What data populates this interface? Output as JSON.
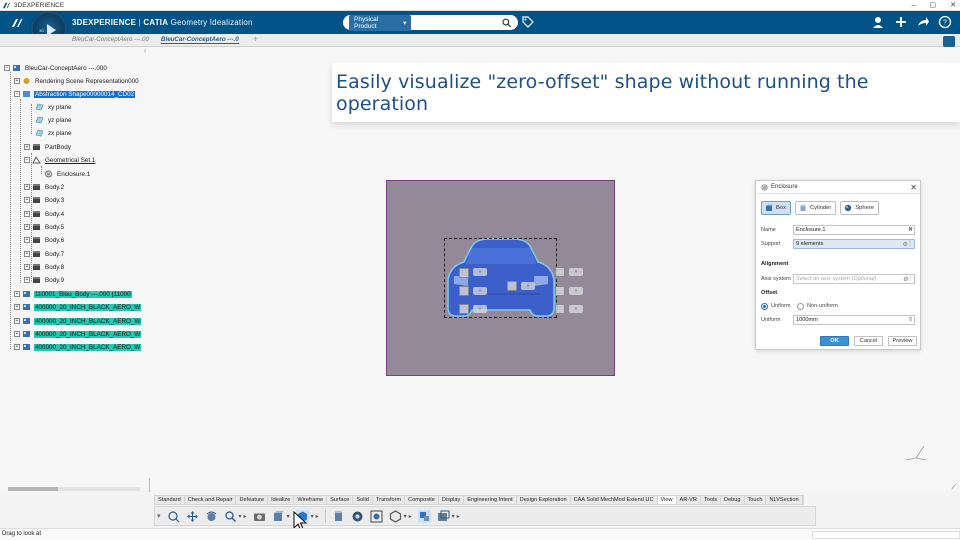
{
  "os": {
    "title": "3DEXPERIENCE"
  },
  "header": {
    "brand_bold": "3DEXPERIENCE",
    "brand_sep": " | ",
    "brand_product": "CATIA",
    "brand_app": " Geometry Idealization",
    "search_scope": "Physical Product",
    "search_value": "",
    "compass_version": "V.R",
    "compass_num": "3D"
  },
  "tabs": [
    {
      "label": "BleuCar-ConceptAero ---.00"
    },
    {
      "label": "BleuCar-ConceptAero ---.0"
    }
  ],
  "tab_add": "+",
  "tree": [
    {
      "label": "BleuCar-ConceptAero ---.000"
    },
    {
      "label": "Rendering Scene Representation000"
    },
    {
      "label": "Abstraction Shape00000014_CD02"
    },
    {
      "label": "xy plane"
    },
    {
      "label": "yz plane"
    },
    {
      "label": "zx plane"
    },
    {
      "label": "PartBody"
    },
    {
      "label": "Geometrical Set.1"
    },
    {
      "label": "Enclosure.1"
    },
    {
      "label": "Body.2"
    },
    {
      "label": "Body.3"
    },
    {
      "label": "Body.4"
    },
    {
      "label": "Body.5"
    },
    {
      "label": "Body.6"
    },
    {
      "label": "Body.7"
    },
    {
      "label": "Body.8"
    },
    {
      "label": "Body.9"
    },
    {
      "label": "110001_Bleu_Body ---.000 (11000"
    },
    {
      "label": "400000_20_INCH_BLACK_AERO_W"
    },
    {
      "label": "400000_20_INCH_BLACK_AERO_W"
    },
    {
      "label": "400000_20_INCH_BLACK_AERO_W"
    },
    {
      "label": "400000_20_INCH_BLACK_AERO_W"
    }
  ],
  "banner": {
    "text": "Easily visualize \"zero-offset\" shape without running the operation"
  },
  "manip_label": "»",
  "panel": {
    "title": "Enclosure",
    "shape_box": "Box",
    "shape_cylinder": "Cylinder",
    "shape_sphere": "Sphere",
    "name_label": "Name",
    "name_value": "Enclosure.1",
    "support_label": "Support",
    "support_value": "9 elements",
    "alignment_label": "Alignment",
    "axis_label": "Axis system",
    "axis_placeholder": "Select an axis system (Optional)",
    "offset_label": "Offset",
    "uniform_option": "Uniform",
    "nonuniform_option": "Non-uniform",
    "uniform_label": "Uniform",
    "uniform_value": "1000mm",
    "ok": "OK",
    "cancel": "Cancel",
    "preview": "Preview"
  },
  "section_tabs": [
    "Standard",
    "Check and Repair",
    "Defeature",
    "Idealize",
    "Wireframe",
    "Surface",
    "Solid",
    "Transform",
    "Composite",
    "Display",
    "Engineering Intent",
    "Design Exploration",
    "CAA Solid MechMod Extend UC",
    "View",
    "AR-VR",
    "Tools",
    "Debug",
    "Touch",
    "NLVSection"
  ],
  "active_section": "View",
  "status": {
    "text": "Drag to look at"
  },
  "colors": {
    "header_bg": "#005386",
    "selection": "#1a6fd6",
    "highlight": "#22c9b3",
    "canvas_bg": "#948999",
    "car_blue": "#3d5fc9",
    "banner_text": "#1d4f8a"
  }
}
